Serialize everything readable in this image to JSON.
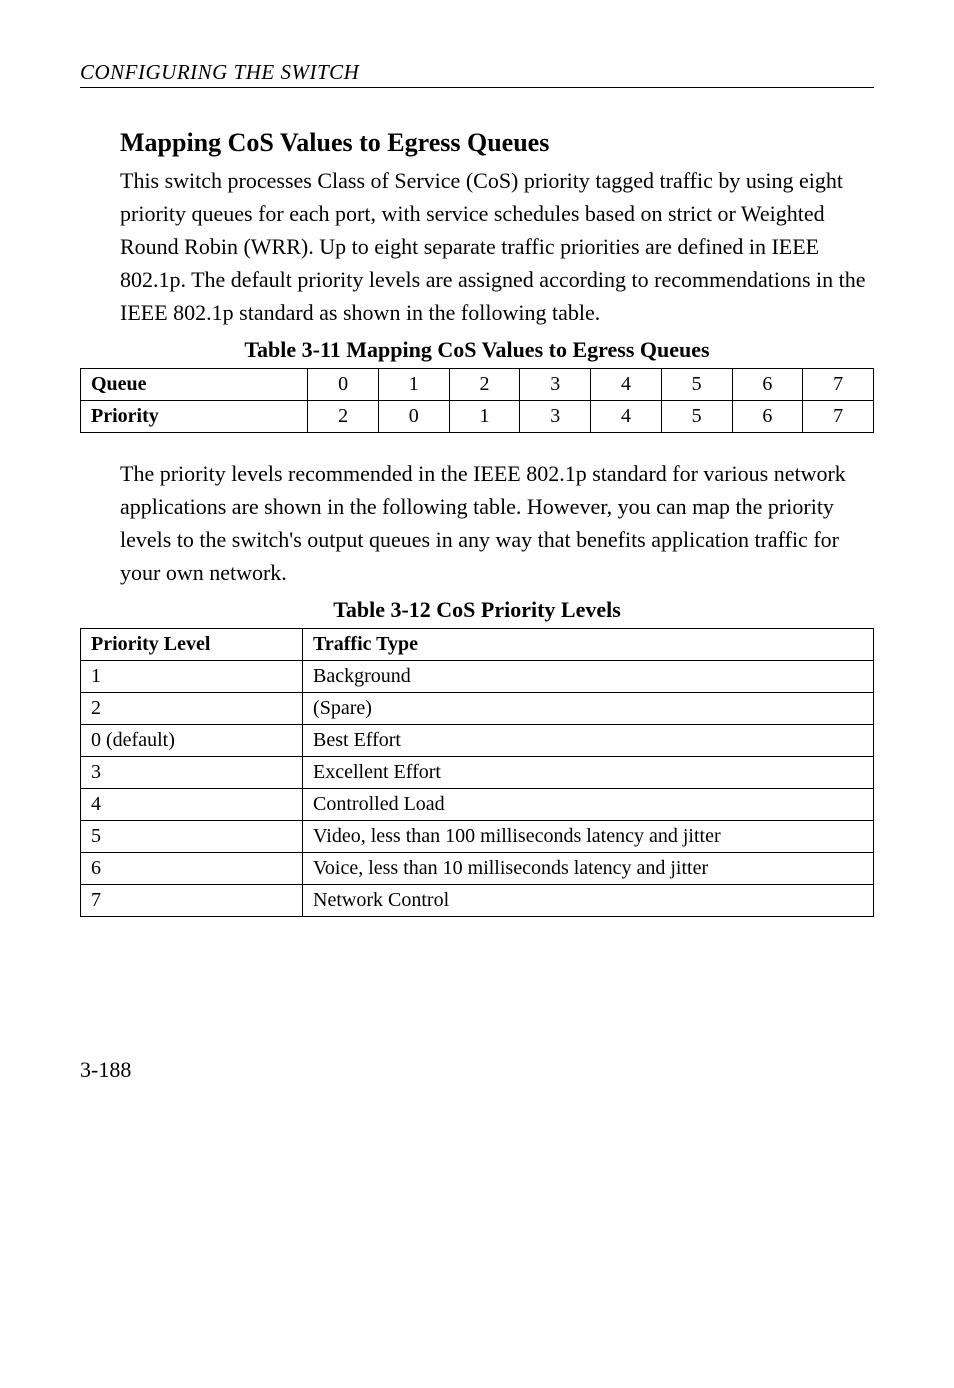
{
  "header": {
    "running": "CONFIGURING THE SWITCH"
  },
  "section": {
    "title": "Mapping CoS Values to Egress Queues",
    "intro": "This switch processes Class of Service (CoS) priority tagged traffic by using eight priority queues for each port, with service schedules based on strict or Weighted Round Robin (WRR). Up to eight separate traffic priorities are defined in IEEE 802.1p. The default priority levels are assigned according to recommendations in the IEEE 802.1p standard as shown in the following table.",
    "mid_para": "The priority levels recommended in the IEEE 802.1p standard for various network applications are shown in the following table. However, you can map the priority levels to the switch's output queues in any way that benefits application traffic for your own network."
  },
  "tables": {
    "t311": {
      "caption": "Table 3-11  Mapping CoS Values to Egress Queues",
      "row_queue_label": "Queue",
      "row_queue": [
        "0",
        "1",
        "2",
        "3",
        "4",
        "5",
        "6",
        "7"
      ],
      "row_priority_label": "Priority",
      "row_priority": [
        "2",
        "0",
        "1",
        "3",
        "4",
        "5",
        "6",
        "7"
      ]
    },
    "t312": {
      "caption": "Table 3-12  CoS Priority Levels",
      "headers": [
        "Priority Level",
        "Traffic Type"
      ],
      "rows": [
        [
          "1",
          "Background"
        ],
        [
          "2",
          "(Spare)"
        ],
        [
          "0 (default)",
          "Best Effort"
        ],
        [
          "3",
          "Excellent Effort"
        ],
        [
          "4",
          "Controlled Load"
        ],
        [
          "5",
          "Video, less than 100 milliseconds latency and jitter"
        ],
        [
          "6",
          "Voice, less than 10 milliseconds latency and jitter"
        ],
        [
          "7",
          "Network Control"
        ]
      ]
    }
  },
  "page_number": "3-188"
}
